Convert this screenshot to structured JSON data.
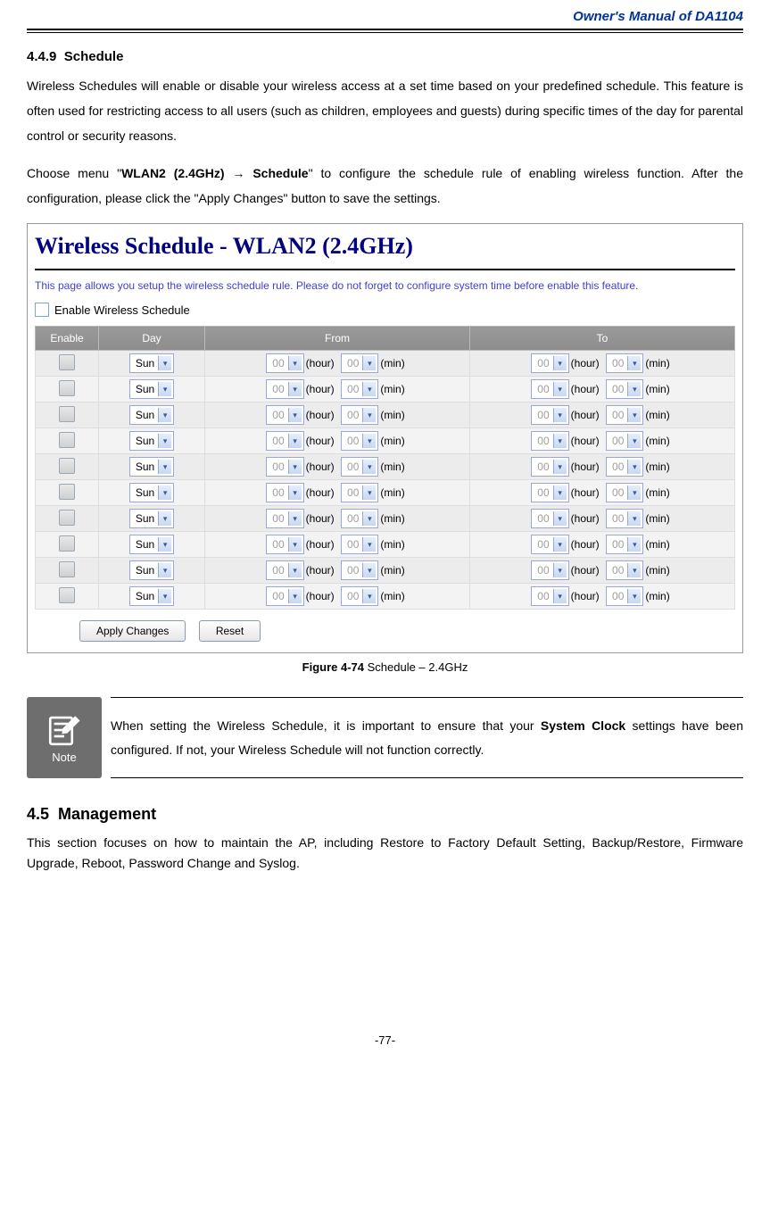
{
  "header": {
    "manual_title": "Owner's Manual of DA1104"
  },
  "section449": {
    "number": "4.4.9",
    "title": "Schedule",
    "para1": "Wireless Schedules will enable or disable your wireless access at a set time based on your predefined schedule. This feature is often used for restricting access to all users (such as children, employees and guests) during specific times of the day for parental control or security reasons.",
    "para2_pre": "Choose menu \"",
    "para2_bold": "WLAN2 (2.4GHz) → Schedule",
    "para2_post": "\" to configure the schedule rule of enabling wireless function. After the configuration, please click the \"Apply Changes\" button to save the settings."
  },
  "screenshot": {
    "title": "Wireless Schedule - WLAN2 (2.4GHz)",
    "desc": "This page allows you setup the wireless schedule rule. Please do not forget to configure system time before enable this feature.",
    "enable_label": "Enable Wireless Schedule",
    "cols": {
      "enable": "Enable",
      "day": "Day",
      "from": "From",
      "to": "To"
    },
    "row": {
      "day": "Sun",
      "hour_val": "00",
      "min_val": "00",
      "hour_unit": "(hour)",
      "min_unit": "(min)"
    },
    "row_count": 10,
    "buttons": {
      "apply": "Apply Changes",
      "reset": "Reset"
    }
  },
  "caption": {
    "bold": "Figure 4-74",
    "rest": " Schedule – 2.4GHz"
  },
  "note": {
    "label": "Note",
    "text_pre": "When setting the Wireless Schedule, it is important to ensure that your ",
    "text_bold": "System Clock",
    "text_post": " settings have been configured. If not, your Wireless Schedule will not function correctly."
  },
  "section45": {
    "number": "4.5",
    "title": "Management",
    "para": "This section focuses on how to maintain the AP, including Restore to Factory Default Setting, Backup/Restore, Firmware Upgrade, Reboot, Password Change and Syslog."
  },
  "footer": {
    "page": "-77-"
  }
}
